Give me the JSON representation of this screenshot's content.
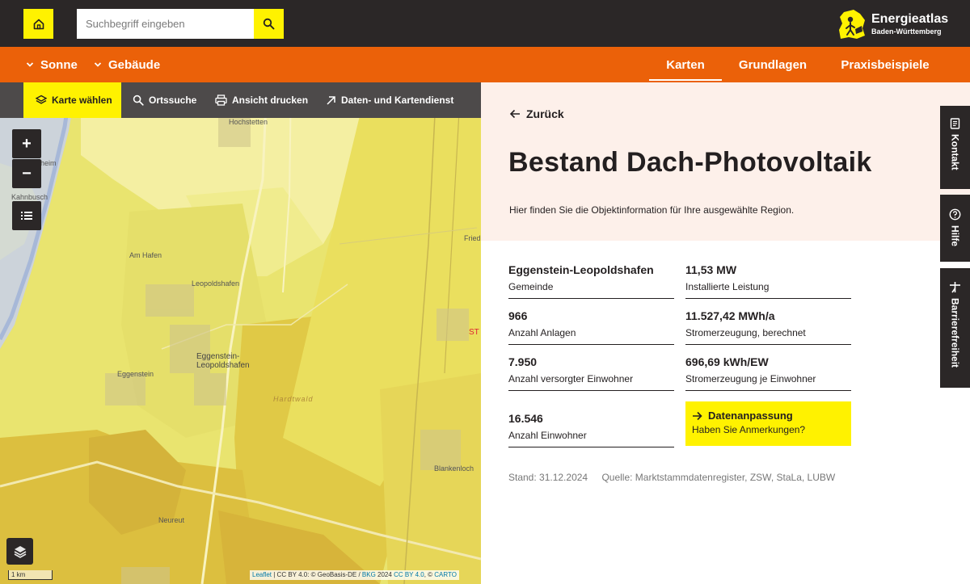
{
  "header": {
    "search_placeholder": "Suchbegriff eingeben",
    "logo_title": "Energieatlas",
    "logo_subtitle": "Baden-Württemberg"
  },
  "nav": {
    "left": [
      {
        "label": "Sonne"
      },
      {
        "label": "Gebäude"
      }
    ],
    "right": [
      {
        "label": "Karten",
        "active": true
      },
      {
        "label": "Grundlagen"
      },
      {
        "label": "Praxisbeispiele"
      }
    ]
  },
  "map_toolbar": {
    "items": [
      {
        "label": "Karte wählen",
        "icon": "layers-icon",
        "active": true
      },
      {
        "label": "Ortssuche",
        "icon": "search-icon"
      },
      {
        "label": "Ansicht drucken",
        "icon": "printer-icon"
      },
      {
        "label": "Daten- und Kartendienst",
        "icon": "arrow-up-right-icon"
      }
    ]
  },
  "map": {
    "zoom_in": "+",
    "zoom_out": "−",
    "scale_label": "1 km",
    "labels": {
      "linkenheim": "Linkenheim-\nHochstetten",
      "eggenstein": "Eggenstein-\nLeopoldshafen",
      "hardtwald": "Hardtwald",
      "am_hafen": "Am Hafen",
      "kahnbusch": "Kahnbusch",
      "heim": "heim",
      "neureut": "Neureut",
      "blankenloch": "Blankenloch",
      "fried": "Fried",
      "leopoldshafen_small": "Leopoldshafen",
      "eggenstein_small": "Eggenstein",
      "st": "ST"
    },
    "attribution": {
      "leaflet": "Leaflet",
      "text1": " | CC BY 4.0: © GeoBasis-DE / ",
      "bkg": "BKG",
      "text2": " 2024 ",
      "ccby": "CC BY 4.0",
      "text3": ", © ",
      "carto": "CARTO"
    }
  },
  "panel": {
    "back_label": "Zurück",
    "title": "Bestand Dach-Photovoltaik",
    "intro": "Hier finden Sie die Objektinformation für Ihre ausgewählte Region.",
    "stats": [
      {
        "value": "Eggenstein-Leopoldshafen",
        "label": "Gemeinde"
      },
      {
        "value": "11,53 MW",
        "label": "Installierte Leistung"
      },
      {
        "value": "966",
        "label": "Anzahl Anlagen"
      },
      {
        "value": "11.527,42 MWh/a",
        "label": "Stromerzeugung, berechnet"
      },
      {
        "value": "7.950",
        "label": "Anzahl versorgter Einwohner"
      },
      {
        "value": "696,69 kWh/EW",
        "label": "Stromerzeugung je Einwohner"
      },
      {
        "value": "16.546",
        "label": "Anzahl Einwohner"
      }
    ],
    "data_adjust": {
      "title": "Datenanpassung",
      "subtitle": "Haben Sie Anmerkungen?"
    },
    "stand": "Stand: 31.12.2024",
    "quelle": "Quelle: Marktstammdatenregister, ZSW, StaLa, LUBW"
  },
  "side_tabs": [
    {
      "label": "Kontakt",
      "icon": "contact-icon"
    },
    {
      "label": "Hilfe",
      "icon": "help-icon"
    },
    {
      "label": "Barrierefreiheit",
      "icon": "accessibility-icon"
    }
  ],
  "colors": {
    "brand_yellow": "#fff200",
    "brand_orange": "#eb6109",
    "dark": "#2b2727",
    "panel_head_bg": "#fdf0ea"
  }
}
